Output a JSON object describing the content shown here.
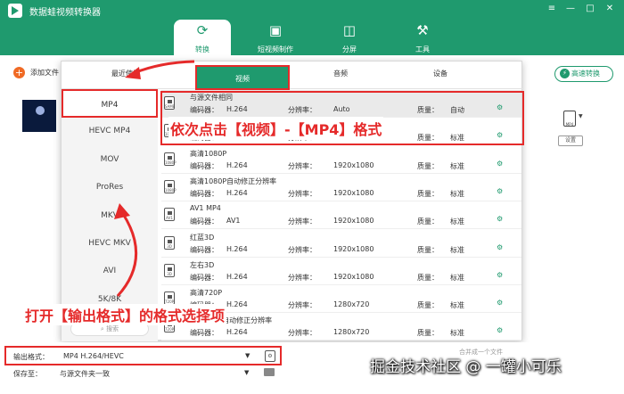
{
  "app": {
    "title": "数据蛙视频转换器"
  },
  "window_controls": {
    "menu": "≡",
    "minimize": "—",
    "maximize": "□",
    "close": "✕"
  },
  "nav": [
    {
      "label": "转换",
      "icon": "⟳"
    },
    {
      "label": "短视频制作",
      "icon": "▣"
    },
    {
      "label": "分屏",
      "icon": "◫"
    },
    {
      "label": "工具",
      "icon": "⚒"
    }
  ],
  "toolbar": {
    "add_label": "添加文件",
    "fast_convert": "高速转换",
    "settings": "设置",
    "right_format_icon": "MP4"
  },
  "popup": {
    "tabs": [
      "最近使用",
      "视频",
      "音频",
      "设备"
    ],
    "formats": [
      "MP4",
      "HEVC MP4",
      "MOV",
      "ProRes",
      "MKV",
      "HEVC MKV",
      "AVI",
      "5K/8K"
    ],
    "search_label": "搜索",
    "col_labels": {
      "encoder": "编码器：",
      "resolution": "分辨率：",
      "quality": "质量："
    },
    "rows": [
      {
        "title": "与源文件相同",
        "encoder": "H.264",
        "resolution": "Auto",
        "quality": "自动",
        "icon": "SAME"
      },
      {
        "title": "高清1080P",
        "encoder": "H.264",
        "resolution": "1920x1080",
        "quality": "标准",
        "icon": "1080P"
      },
      {
        "title": "高清1080P",
        "encoder": "H.264",
        "resolution": "1920x1080",
        "quality": "标准",
        "icon": "1080P"
      },
      {
        "title": "高清1080P自动修正分辨率",
        "encoder": "H.264",
        "resolution": "1920x1080",
        "quality": "标准",
        "icon": "1080P"
      },
      {
        "title": "AV1 MP4",
        "encoder": "AV1",
        "resolution": "1920x1080",
        "quality": "标准",
        "icon": "AV1"
      },
      {
        "title": "红蓝3D",
        "encoder": "H.264",
        "resolution": "1920x1080",
        "quality": "标准",
        "icon": "3D"
      },
      {
        "title": "左右3D",
        "encoder": "H.264",
        "resolution": "1920x1080",
        "quality": "标准",
        "icon": "3D"
      },
      {
        "title": "高清720P",
        "encoder": "H.264",
        "resolution": "1280x720",
        "quality": "标准",
        "icon": "720P"
      },
      {
        "title": "高清720P自动修正分辨率",
        "encoder": "H.264",
        "resolution": "1280x720",
        "quality": "标准",
        "icon": "720P"
      }
    ]
  },
  "bottom": {
    "output_label": "输出格式：",
    "output_value": "MP4 H.264/HEVC",
    "saveto_label": "保存至：",
    "saveto_value": "与源文件夹一致",
    "merge_label": "合并成一个文件"
  },
  "annotations": {
    "step1": "依次点击【视频】-【MP4】格式",
    "step2": "打开【输出格式】的格式选择项"
  },
  "watermark": "掘金技术社区 @ 一罐小可乐",
  "colors": {
    "brand": "#1f9a6e",
    "annotation": "#e52a2a",
    "accent": "#f06a24"
  }
}
